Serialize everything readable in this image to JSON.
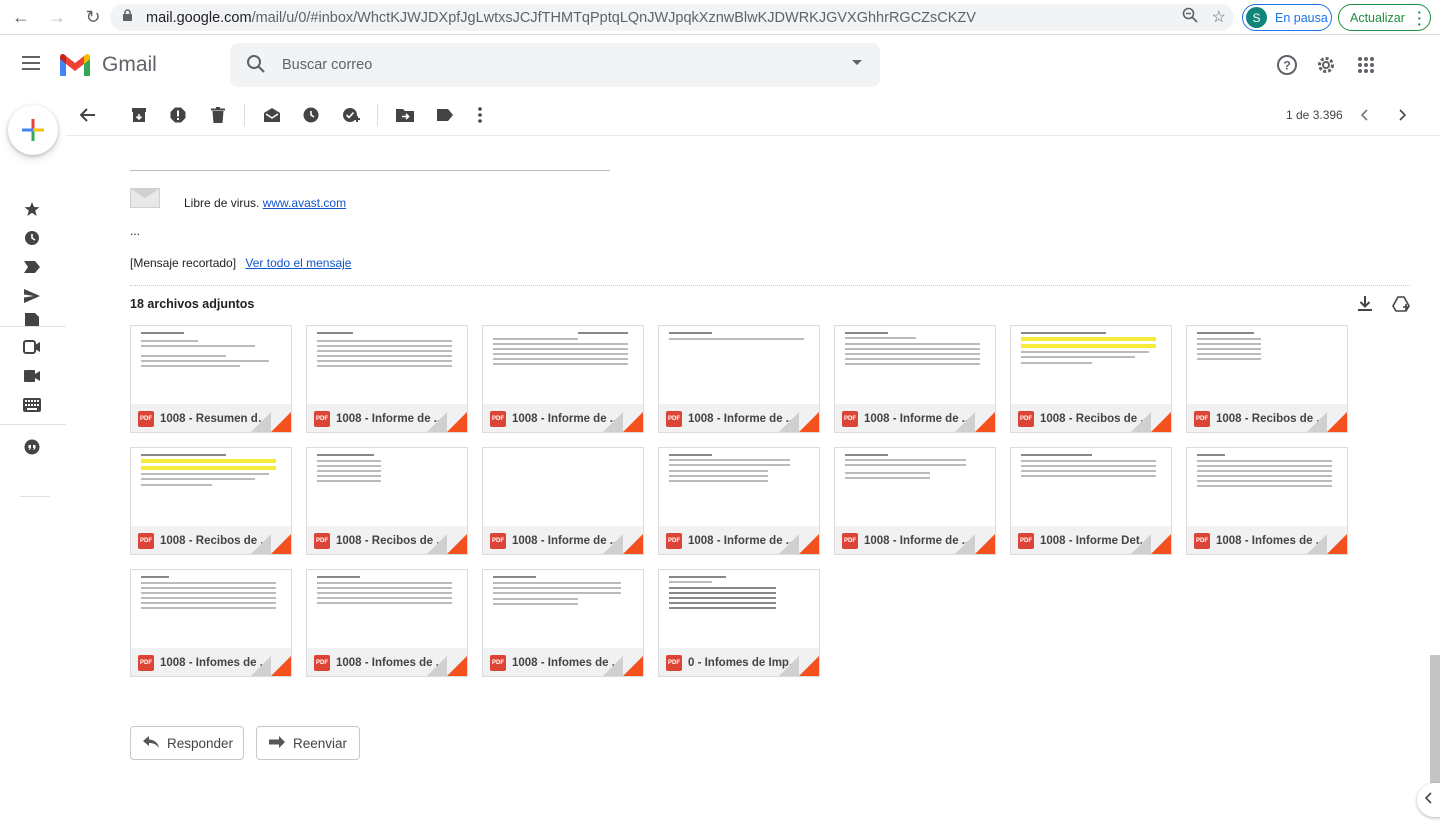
{
  "browser": {
    "url_host": "mail.google.com",
    "url_rest": "/mail/u/0/#inbox/WhctKJWJDXpfJgLwtxsJCJfTHMTqPptqLQnJWJpqkXznwBlwKJDWRKJGVXGhhrRGCZsCKZV",
    "profile_initial": "S",
    "profile_status": "En pausa",
    "update_label": "Actualizar"
  },
  "gmail": {
    "app_name": "Gmail",
    "search_placeholder": "Buscar correo"
  },
  "toolbar": {
    "pager": "1 de 3.396"
  },
  "message": {
    "virus_text": "Libre de virus.",
    "virus_link": "www.avast.com",
    "ellipsis": "...",
    "clipped_text": "[Mensaje recortado]",
    "view_all_link": "Ver todo el mensaje",
    "attachments_title": "18 archivos adjuntos"
  },
  "attachments": [
    {
      "name": "1008 - Resumen de ..."
    },
    {
      "name": "1008 - Informe de ..."
    },
    {
      "name": "1008 - Informe de ..."
    },
    {
      "name": "1008 - Informe de ..."
    },
    {
      "name": "1008 - Informe de ..."
    },
    {
      "name": "1008 - Recibos de ..."
    },
    {
      "name": "1008 - Recibos de ..."
    },
    {
      "name": "1008 - Recibos de ..."
    },
    {
      "name": "1008 - Recibos de ..."
    },
    {
      "name": "1008 - Informe de ..."
    },
    {
      "name": "1008 - Informe de ..."
    },
    {
      "name": "1008 - Informe de ..."
    },
    {
      "name": "1008 - Informe Det..."
    },
    {
      "name": "1008 - Infomes de ..."
    },
    {
      "name": "1008 - Infomes de ..."
    },
    {
      "name": "1008 - Infomes de ..."
    },
    {
      "name": "1008 - Infomes de ..."
    },
    {
      "name": "0 - Infomes de Imp..."
    }
  ],
  "file_type_badge": "PDF",
  "actions": {
    "reply": "Responder",
    "forward": "Reenviar"
  }
}
